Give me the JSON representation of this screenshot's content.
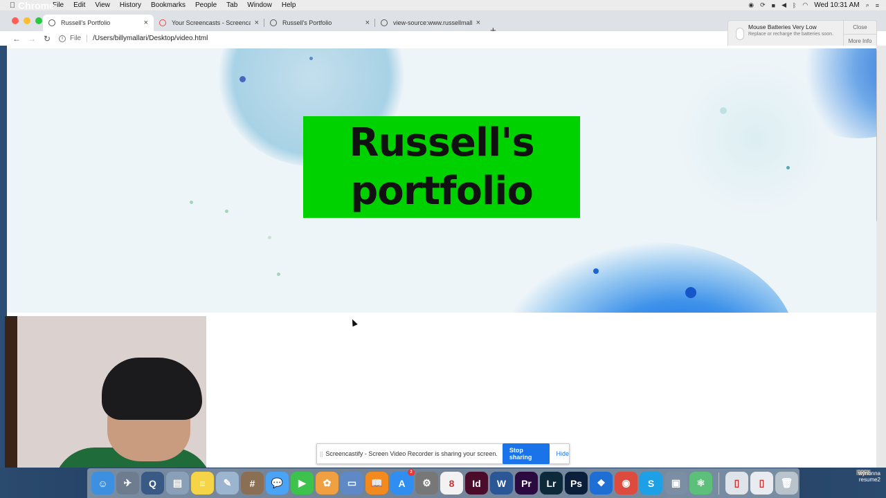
{
  "menubar": {
    "items": [
      "Chrome",
      "File",
      "Edit",
      "View",
      "History",
      "Bookmarks",
      "People",
      "Tab",
      "Window",
      "Help"
    ],
    "clock": "Wed 10:31 AM"
  },
  "browser": {
    "tabs": [
      {
        "label": "Russell's Portfolio",
        "active": true
      },
      {
        "label": "Your Screencasts - Screencas",
        "active": false
      },
      {
        "label": "Russell's Portfolio",
        "active": false
      },
      {
        "label": "view-source:www.russellmalla",
        "active": false
      }
    ],
    "address": {
      "scheme": "File",
      "url": "/Users/billymallari/Desktop/video.html"
    }
  },
  "notification": {
    "title": "Mouse Batteries Very Low",
    "body": "Replace or recharge the batteries soon.",
    "close_label": "Close",
    "more_label": "More Info"
  },
  "page": {
    "hero_title_line1": "Russell's",
    "hero_title_line2": "portfolio",
    "hero_bg_color": "#00d200"
  },
  "screencastify": {
    "message": "Screencastify - Screen Video Recorder is sharing your screen.",
    "stop_label": "Stop sharing",
    "hide_label": "Hide"
  },
  "dock": {
    "apps": [
      {
        "name": "finder-icon",
        "glyph": "☺",
        "color": "#3d8fe0"
      },
      {
        "name": "launchpad-icon",
        "glyph": "✈",
        "color": "#6d7d8f"
      },
      {
        "name": "quicktime-icon",
        "glyph": "Q",
        "color": "#3a5a86"
      },
      {
        "name": "preview-icon",
        "glyph": "▤",
        "color": "#8aa0b8"
      },
      {
        "name": "notes-icon",
        "glyph": "≡",
        "color": "#f5d547"
      },
      {
        "name": "script-editor-icon",
        "glyph": "✎",
        "color": "#9bb4cf"
      },
      {
        "name": "calculator-icon",
        "glyph": "#",
        "color": "#8b6f54"
      },
      {
        "name": "messages-icon",
        "glyph": "💬",
        "color": "#4aa3f5"
      },
      {
        "name": "facetime-icon",
        "glyph": "▶",
        "color": "#3ec24e"
      },
      {
        "name": "photos-icon",
        "glyph": "✿",
        "color": "#f0a040"
      },
      {
        "name": "keynote-icon",
        "glyph": "▭",
        "color": "#5f88c7"
      },
      {
        "name": "ibooks-icon",
        "glyph": "📖",
        "color": "#f28a1e"
      },
      {
        "name": "app-store-icon",
        "glyph": "A",
        "color": "#2f8ef0",
        "badge": "2"
      },
      {
        "name": "system-preferences-icon",
        "glyph": "⚙",
        "color": "#777"
      },
      {
        "name": "calendar-icon",
        "glyph": "8",
        "color": "#f2f2f2"
      },
      {
        "name": "indesign-icon",
        "glyph": "Id",
        "color": "#4b0b2a"
      },
      {
        "name": "word-icon",
        "glyph": "W",
        "color": "#2b5797"
      },
      {
        "name": "premiere-icon",
        "glyph": "Pr",
        "color": "#2a0a3f"
      },
      {
        "name": "lightroom-icon",
        "glyph": "Lr",
        "color": "#0d2a3a"
      },
      {
        "name": "photoshop-icon",
        "glyph": "Ps",
        "color": "#0b1f3a"
      },
      {
        "name": "dropbox-icon",
        "glyph": "❖",
        "color": "#1f6ed4"
      },
      {
        "name": "chrome-icon",
        "glyph": "◉",
        "color": "#dd4b3e"
      },
      {
        "name": "skype-icon",
        "glyph": "S",
        "color": "#1ea0e6"
      },
      {
        "name": "image-capture-icon",
        "glyph": "▣",
        "color": "#7c8ea3"
      },
      {
        "name": "atom-icon",
        "glyph": "⚛",
        "color": "#5cbf7a"
      },
      {
        "name": "document-icon",
        "glyph": "▯",
        "color": "#dfe4ea"
      },
      {
        "name": "jpeg-file-icon",
        "glyph": "▯",
        "color": "#e8ecf0"
      },
      {
        "name": "trash-icon",
        "glyph": "🗑",
        "color": "#b9c3cc"
      }
    ]
  },
  "desktop": {
    "file_label_line1": "wynonna",
    "file_label_line2": "resume2",
    "docx_label": "DOCX"
  }
}
